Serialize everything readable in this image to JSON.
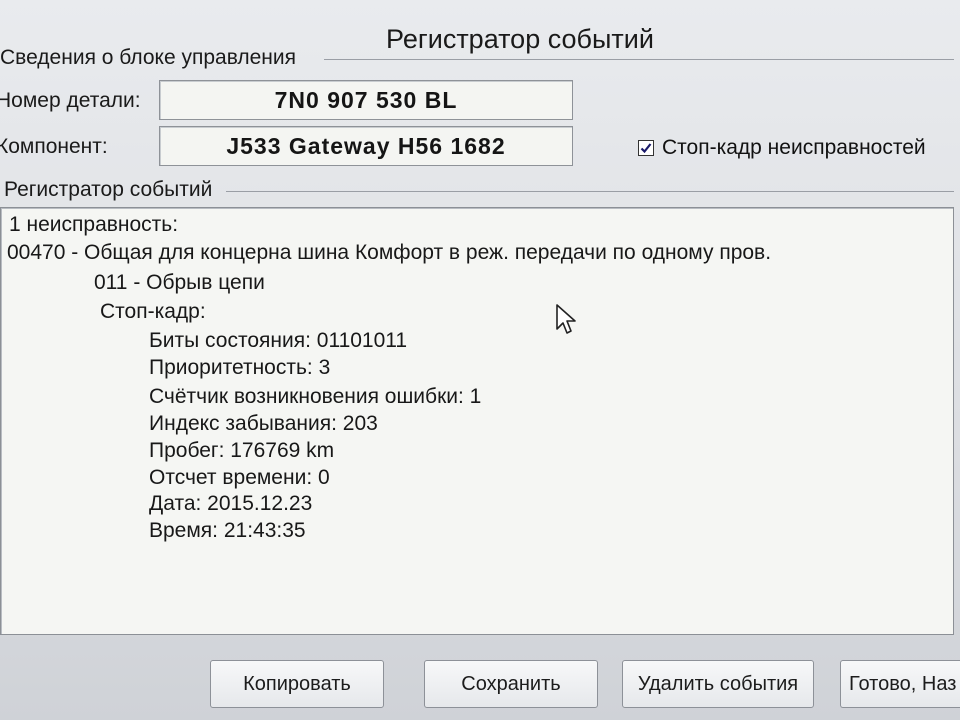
{
  "window": {
    "title": "Регистратор событий"
  },
  "control_unit": {
    "group_label": "Сведения о блоке управления",
    "part_number_label": "Номер детали:",
    "part_number_value": "7N0 907 530 BL",
    "component_label": "Компонент:",
    "component_value": "J533  Gateway H56 1682",
    "freeze_frame_checkbox_label": "Стоп-кадр неисправностей",
    "freeze_frame_checked": true
  },
  "event_log": {
    "group_label": "Регистратор событий",
    "fault_count": "1 неисправность:",
    "fault_code_line": "00470 - Общая для концерна шина Комфорт в реж. передачи по одному пров.",
    "fault_subcode_line": "011 - Обрыв цепи",
    "freeze_frame_header": "Стоп-кадр:",
    "freeze_frame": {
      "status_bits": "Биты состояния: 01101011",
      "priority": "Приоритетность: 3",
      "occurrence_counter": "Счётчик возникновения ошибки: 1",
      "forget_index": "Индекс забывания: 203",
      "mileage": "Пробег: 176769 km",
      "time_indication": "Отсчет времени: 0",
      "date": "Дата: 2015.12.23",
      "time": "Время: 21:43:35"
    }
  },
  "buttons": {
    "copy": "Копировать",
    "save": "Сохранить",
    "delete_events": "Удалить события",
    "done": "Готово, Наз"
  }
}
